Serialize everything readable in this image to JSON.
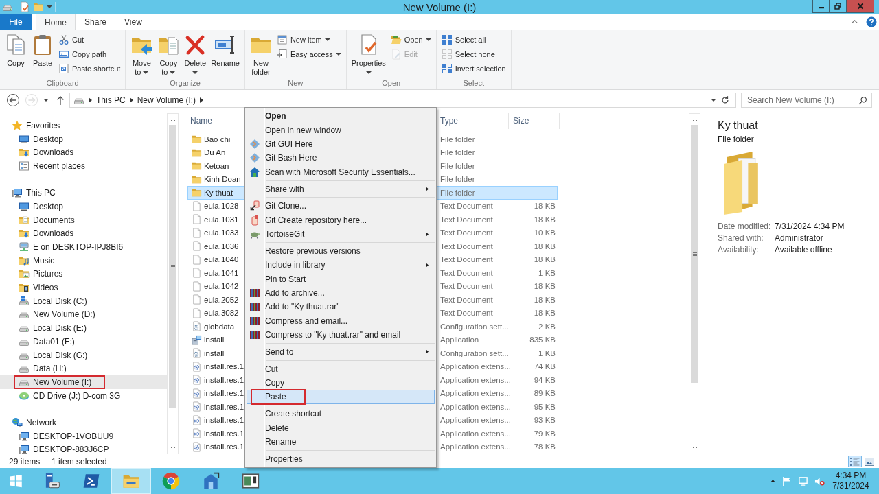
{
  "window": {
    "title": "New Volume (I:)"
  },
  "ribbon": {
    "tabs": [
      {
        "label": "File",
        "kind": "menu",
        "selected": false
      },
      {
        "label": "Home",
        "kind": "tab",
        "selected": true
      },
      {
        "label": "Share",
        "kind": "tab",
        "selected": false
      },
      {
        "label": "View",
        "kind": "tab",
        "selected": false
      }
    ],
    "groups": [
      {
        "label": "Clipboard",
        "large": [
          {
            "label": "Copy",
            "kind": "copy",
            "dropdown": false,
            "disabled": false
          },
          {
            "label": "Paste",
            "kind": "paste",
            "dropdown": false,
            "disabled": false
          }
        ],
        "small": [
          {
            "label": "Cut",
            "kind": "cut",
            "dropdown": false,
            "disabled": false
          },
          {
            "label": "Copy path",
            "kind": "copy-path",
            "dropdown": false,
            "disabled": false
          },
          {
            "label": "Paste shortcut",
            "kind": "paste-shortcut",
            "dropdown": false,
            "disabled": false
          }
        ]
      },
      {
        "label": "Organize",
        "large": [
          {
            "label": "Move to",
            "kind": "move-to",
            "dropdown": true,
            "disabled": false
          },
          {
            "label": "Copy to",
            "kind": "copy-to",
            "dropdown": true,
            "disabled": false
          },
          {
            "label": "Delete",
            "kind": "delete",
            "dropdown": true,
            "disabled": false
          },
          {
            "label": "Rename",
            "kind": "rename",
            "dropdown": false,
            "disabled": false
          }
        ]
      },
      {
        "label": "New",
        "large": [
          {
            "label": "New folder",
            "kind": "new-folder",
            "dropdown": false,
            "disabled": false
          }
        ],
        "small": [
          {
            "label": "New item",
            "kind": "new-item",
            "dropdown": true,
            "disabled": false
          },
          {
            "label": "Easy access",
            "kind": "easy-access",
            "dropdown": true,
            "disabled": false
          }
        ]
      },
      {
        "label": "Open",
        "large": [
          {
            "label": "Properties",
            "kind": "properties",
            "dropdown": true,
            "disabled": false
          }
        ],
        "small": [
          {
            "label": "Open",
            "kind": "open",
            "dropdown": true,
            "disabled": false
          },
          {
            "label": "Edit",
            "kind": "edit",
            "dropdown": false,
            "disabled": true
          }
        ]
      },
      {
        "label": "Select",
        "small": [
          {
            "label": "Select all",
            "kind": "select-all",
            "dropdown": false,
            "disabled": false
          },
          {
            "label": "Select none",
            "kind": "select-none",
            "dropdown": false,
            "disabled": false
          },
          {
            "label": "Invert selection",
            "kind": "invert-selection",
            "dropdown": false,
            "disabled": false
          }
        ]
      }
    ]
  },
  "address_bar": {
    "history_buttons": [
      {
        "kind": "back",
        "disabled": false
      },
      {
        "kind": "forward",
        "disabled": true
      }
    ],
    "breadcrumbs": [
      "This PC",
      "New Volume (I:)"
    ]
  },
  "search": {
    "placeholder": "Search New Volume (I:)"
  },
  "navigation": [
    {
      "label": "Favorites",
      "kind": "favorites",
      "selected": false,
      "annotated": false,
      "children": [
        {
          "label": "Desktop",
          "kind": "desktop",
          "selected": false,
          "annotated": false
        },
        {
          "label": "Downloads",
          "kind": "downloads",
          "selected": false,
          "annotated": false
        },
        {
          "label": "Recent places",
          "kind": "recent",
          "selected": false,
          "annotated": false
        }
      ]
    },
    {
      "label": "This PC",
      "kind": "computer",
      "selected": false,
      "annotated": false,
      "children": [
        {
          "label": "Desktop",
          "kind": "desktop",
          "selected": false,
          "annotated": false
        },
        {
          "label": "Documents",
          "kind": "documents",
          "selected": false,
          "annotated": false
        },
        {
          "label": "Downloads",
          "kind": "downloads",
          "selected": false,
          "annotated": false
        },
        {
          "label": "E on DESKTOP-IPJ8BI6",
          "kind": "network-drive",
          "selected": false,
          "annotated": false
        },
        {
          "label": "Music",
          "kind": "music",
          "selected": false,
          "annotated": false
        },
        {
          "label": "Pictures",
          "kind": "pictures",
          "selected": false,
          "annotated": false
        },
        {
          "label": "Videos",
          "kind": "videos",
          "selected": false,
          "annotated": false
        },
        {
          "label": "Local Disk (C:)",
          "kind": "system-drive",
          "selected": false,
          "annotated": false
        },
        {
          "label": "New Volume (D:)",
          "kind": "drive",
          "selected": false,
          "annotated": false
        },
        {
          "label": "Local Disk (E:)",
          "kind": "drive",
          "selected": false,
          "annotated": false
        },
        {
          "label": "Data01 (F:)",
          "kind": "drive",
          "selected": false,
          "annotated": false
        },
        {
          "label": "Local Disk (G:)",
          "kind": "drive",
          "selected": false,
          "annotated": false
        },
        {
          "label": "Data (H:)",
          "kind": "drive",
          "selected": false,
          "annotated": false
        },
        {
          "label": "New Volume (I:)",
          "kind": "drive",
          "selected": true,
          "annotated": true
        },
        {
          "label": "CD Drive (J:) D-com 3G",
          "kind": "cd",
          "selected": false,
          "annotated": false
        }
      ]
    },
    {
      "label": "Network",
      "kind": "network",
      "selected": false,
      "annotated": false,
      "children": [
        {
          "label": "DESKTOP-1VOBUU9",
          "kind": "computer",
          "selected": false,
          "annotated": false
        },
        {
          "label": "DESKTOP-883J6CP",
          "kind": "computer",
          "selected": false,
          "annotated": false
        }
      ]
    }
  ],
  "file_list": {
    "columns": [
      "Name",
      "Type",
      "Size"
    ],
    "rows": [
      {
        "name": "Bao chi",
        "type": "File folder",
        "kind": "folder",
        "selected": false
      },
      {
        "name": "Du An",
        "type": "File folder",
        "kind": "folder",
        "selected": false
      },
      {
        "name": "Ketoan",
        "type": "File folder",
        "kind": "folder",
        "selected": false
      },
      {
        "name": "Kinh Doan",
        "type": "File folder",
        "kind": "folder",
        "selected": false
      },
      {
        "name": "Ky thuat",
        "type": "File folder",
        "kind": "folder",
        "selected": true
      },
      {
        "name": "eula.1028",
        "type": "Text Document",
        "size": "18 KB",
        "kind": "text",
        "selected": false
      },
      {
        "name": "eula.1031",
        "type": "Text Document",
        "size": "18 KB",
        "kind": "text",
        "selected": false
      },
      {
        "name": "eula.1033",
        "type": "Text Document",
        "size": "10 KB",
        "kind": "text",
        "selected": false
      },
      {
        "name": "eula.1036",
        "type": "Text Document",
        "size": "18 KB",
        "kind": "text",
        "selected": false
      },
      {
        "name": "eula.1040",
        "type": "Text Document",
        "size": "18 KB",
        "kind": "text",
        "selected": false
      },
      {
        "name": "eula.1041",
        "type": "Text Document",
        "size": "1 KB",
        "kind": "text",
        "selected": false
      },
      {
        "name": "eula.1042",
        "type": "Text Document",
        "size": "18 KB",
        "kind": "text",
        "selected": false
      },
      {
        "name": "eula.2052",
        "type": "Text Document",
        "size": "18 KB",
        "kind": "text",
        "selected": false
      },
      {
        "name": "eula.3082",
        "type": "Text Document",
        "size": "18 KB",
        "kind": "text",
        "selected": false
      },
      {
        "name": "globdata",
        "type": "Configuration sett...",
        "size": "2 KB",
        "kind": "config",
        "selected": false
      },
      {
        "name": "install",
        "type": "Application",
        "size": "835 KB",
        "kind": "application",
        "selected": false
      },
      {
        "name": "install",
        "type": "Configuration sett...",
        "size": "1 KB",
        "kind": "config",
        "selected": false
      },
      {
        "name": "install.res.1",
        "type": "Application extens...",
        "size": "74 KB",
        "kind": "extension",
        "selected": false
      },
      {
        "name": "install.res.1",
        "type": "Application extens...",
        "size": "94 KB",
        "kind": "extension",
        "selected": false
      },
      {
        "name": "install.res.1",
        "type": "Application extens...",
        "size": "89 KB",
        "kind": "extension",
        "selected": false
      },
      {
        "name": "install.res.1",
        "type": "Application extens...",
        "size": "95 KB",
        "kind": "extension",
        "selected": false
      },
      {
        "name": "install.res.1",
        "type": "Application extens...",
        "size": "93 KB",
        "kind": "extension",
        "selected": false
      },
      {
        "name": "install.res.1",
        "type": "Application extens...",
        "size": "79 KB",
        "kind": "extension",
        "selected": false
      },
      {
        "name": "install.res.1",
        "type": "Application extens...",
        "size": "78 KB",
        "kind": "extension",
        "selected": false
      }
    ]
  },
  "context_menu": {
    "groups": [
      {
        "items": [
          {
            "label": "Open",
            "kind": "plain",
            "submenu": false,
            "default": true,
            "selected": false,
            "annotated": false
          },
          {
            "label": "Open in new window",
            "kind": "plain",
            "submenu": false,
            "default": false,
            "selected": false,
            "annotated": false
          },
          {
            "label": "Git GUI Here",
            "kind": "git",
            "submenu": false,
            "default": false,
            "selected": false,
            "annotated": false
          },
          {
            "label": "Git Bash Here",
            "kind": "git",
            "submenu": false,
            "default": false,
            "selected": false,
            "annotated": false
          },
          {
            "label": "Scan with Microsoft Security Essentials...",
            "kind": "security",
            "submenu": false,
            "default": false,
            "selected": false,
            "annotated": false
          }
        ]
      },
      {
        "items": [
          {
            "label": "Share with",
            "kind": "plain",
            "submenu": true,
            "default": false,
            "selected": false,
            "annotated": false
          }
        ]
      },
      {
        "items": [
          {
            "label": "Git Clone...",
            "kind": "git-clone",
            "submenu": false,
            "default": false,
            "selected": false,
            "annotated": false
          },
          {
            "label": "Git Create repository here...",
            "kind": "git-repo",
            "submenu": false,
            "default": false,
            "selected": false,
            "annotated": false
          },
          {
            "label": "TortoiseGit",
            "kind": "tortoise",
            "submenu": true,
            "default": false,
            "selected": false,
            "annotated": false
          }
        ]
      },
      {
        "items": [
          {
            "label": "Restore previous versions",
            "kind": "plain",
            "submenu": false,
            "default": false,
            "selected": false,
            "annotated": false
          },
          {
            "label": "Include in library",
            "kind": "plain",
            "submenu": true,
            "default": false,
            "selected": false,
            "annotated": false
          },
          {
            "label": "Pin to Start",
            "kind": "plain",
            "submenu": false,
            "default": false,
            "selected": false,
            "annotated": false
          },
          {
            "label": "Add to archive...",
            "kind": "archive",
            "submenu": false,
            "default": false,
            "selected": false,
            "annotated": false
          },
          {
            "label": "Add to \"Ky thuat.rar\"",
            "kind": "archive",
            "submenu": false,
            "default": false,
            "selected": false,
            "annotated": false
          },
          {
            "label": "Compress and email...",
            "kind": "archive",
            "submenu": false,
            "default": false,
            "selected": false,
            "annotated": false
          },
          {
            "label": "Compress to \"Ky thuat.rar\" and email",
            "kind": "archive",
            "submenu": false,
            "default": false,
            "selected": false,
            "annotated": false
          }
        ]
      },
      {
        "items": [
          {
            "label": "Send to",
            "kind": "plain",
            "submenu": true,
            "default": false,
            "selected": false,
            "annotated": false
          }
        ]
      },
      {
        "items": [
          {
            "label": "Cut",
            "kind": "plain",
            "submenu": false,
            "default": false,
            "selected": false,
            "annotated": false
          },
          {
            "label": "Copy",
            "kind": "plain",
            "submenu": false,
            "default": false,
            "selected": false,
            "annotated": false
          },
          {
            "label": "Paste",
            "kind": "plain",
            "submenu": false,
            "default": false,
            "selected": true,
            "annotated": true
          }
        ]
      },
      {
        "items": [
          {
            "label": "Create shortcut",
            "kind": "plain",
            "submenu": false,
            "default": false,
            "selected": false,
            "annotated": false
          },
          {
            "label": "Delete",
            "kind": "plain",
            "submenu": false,
            "default": false,
            "selected": false,
            "annotated": false
          },
          {
            "label": "Rename",
            "kind": "plain",
            "submenu": false,
            "default": false,
            "selected": false,
            "annotated": false
          }
        ]
      },
      {
        "items": [
          {
            "label": "Properties",
            "kind": "plain",
            "submenu": false,
            "default": false,
            "selected": false,
            "annotated": false
          }
        ]
      }
    ]
  },
  "details_pane": {
    "title": "Ky thuat",
    "subtitle": "File folder",
    "properties": [
      {
        "label": "Date modified:",
        "value": "7/31/2024 4:34 PM"
      },
      {
        "label": "Shared with:",
        "value": "Administrator"
      },
      {
        "label": "Availability:",
        "value": "Available offline"
      }
    ]
  },
  "status_bar": {
    "item_count": "29 items",
    "selection": "1 item selected",
    "views": [
      {
        "kind": "details",
        "selected": true
      },
      {
        "kind": "large-icons",
        "selected": false
      }
    ]
  },
  "taskbar": {
    "apps": [
      {
        "kind": "start",
        "selected": false
      },
      {
        "kind": "server-manager",
        "selected": false
      },
      {
        "kind": "powershell",
        "selected": false
      },
      {
        "kind": "file-explorer",
        "selected": true
      },
      {
        "kind": "chrome",
        "selected": false
      },
      {
        "kind": "building",
        "selected": false
      },
      {
        "kind": "window-app",
        "selected": false
      }
    ],
    "clock": {
      "time": "4:34 PM",
      "date": "7/31/2024"
    }
  }
}
